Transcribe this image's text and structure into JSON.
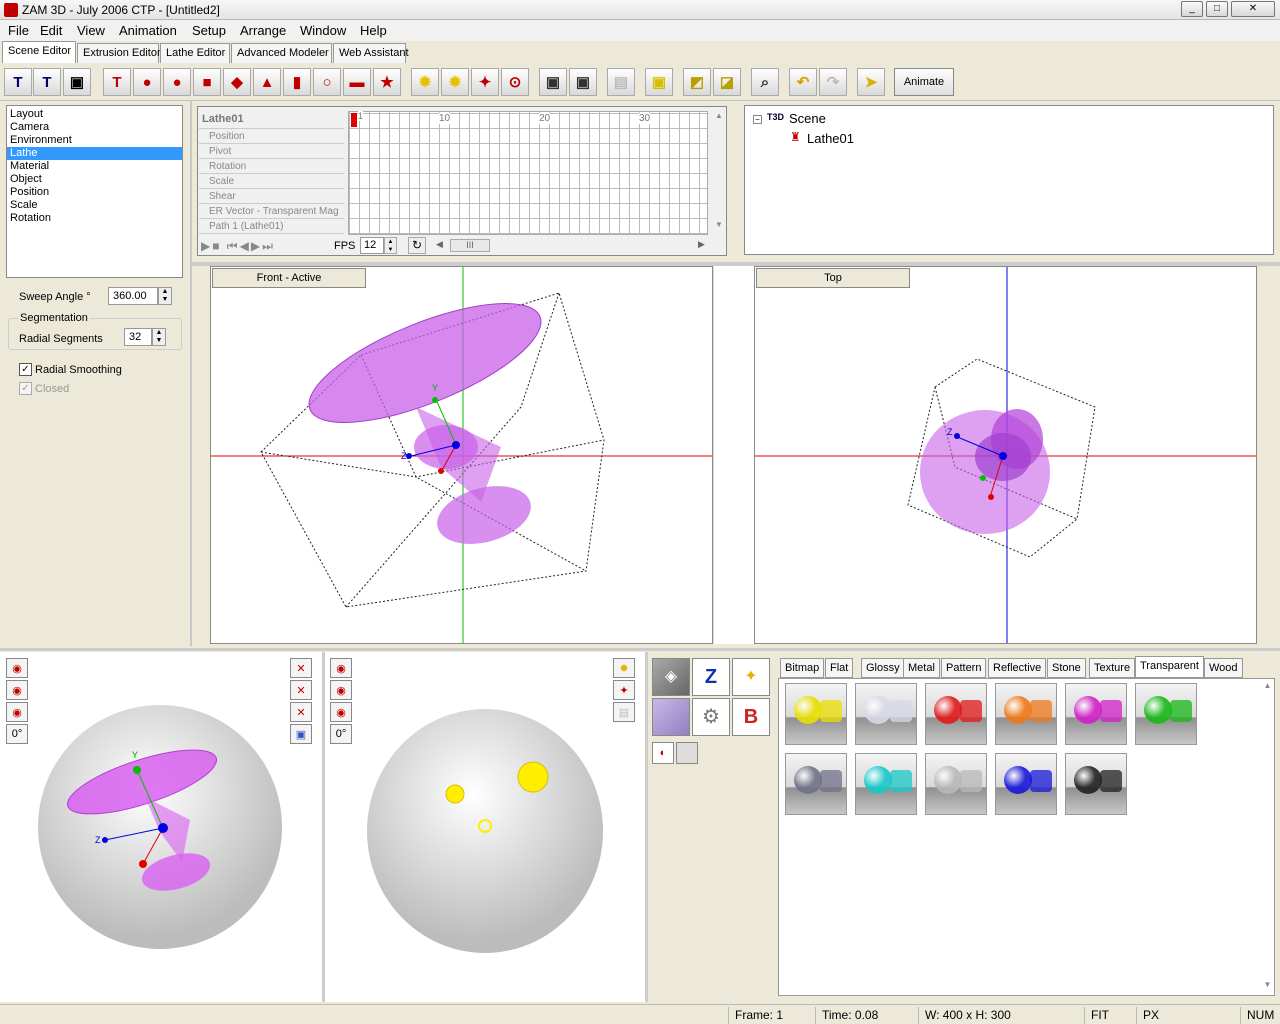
{
  "window": {
    "title": "ZAM 3D - July 2006 CTP - [Untitled2]",
    "minimize": "_",
    "maximize": "□",
    "close": "✕"
  },
  "menu": [
    "File",
    "Edit",
    "View",
    "Animation",
    "Setup",
    "Arrange",
    "Window",
    "Help"
  ],
  "editor_tabs": [
    "Scene Editor",
    "Extrusion Editor",
    "Lathe Editor",
    "Advanced Modeler",
    "Web Assistant"
  ],
  "toolbar": {
    "animate_label": "Animate",
    "icons": [
      "new-scene-icon",
      "import-scene-icon",
      "save-icon",
      "text-icon",
      "sphere-icon",
      "sphere-bevel-icon",
      "cube-icon",
      "pyramid-icon",
      "cone-icon",
      "cylinder-icon",
      "torus-icon",
      "plane-icon",
      "star-icon",
      "light-icon",
      "spot-light-icon",
      "remove-light-icon",
      "directional-light-icon",
      "camera-icon",
      "add-camera-icon",
      "disabled-tool-icon",
      "frame-icon",
      "view-front-icon",
      "view-top-icon",
      "zoom-icon",
      "undo-icon",
      "redo-icon",
      "pointer-icon"
    ]
  },
  "scene_list": {
    "items": [
      "Layout",
      "Camera",
      "Environment",
      "Lathe",
      "Material",
      "Object",
      "Position",
      "Scale",
      "Rotation"
    ],
    "selected": "Lathe"
  },
  "properties": {
    "sweep_angle_label": "Sweep Angle °",
    "sweep_angle_value": "360.00",
    "segmentation_label": "Segmentation",
    "radial_segments_label": "Radial Segments",
    "radial_segments_value": "32",
    "radial_smoothing_label": "Radial Smoothing",
    "closed_label": "Closed"
  },
  "timeline": {
    "object": "Lathe01",
    "tracks": [
      "Position",
      "Pivot",
      "Rotation",
      "Scale",
      "Shear",
      "ER Vector - Transparent Mag",
      "Path 1 (Lathe01)"
    ],
    "ticks": [
      "1",
      "10",
      "20",
      "30"
    ],
    "fps_label": "FPS",
    "fps_value": "12",
    "scroll_thumb": "III"
  },
  "scene_tree": {
    "root": "Scene",
    "child": "Lathe01"
  },
  "viewports": {
    "front": "Front - Active",
    "top": "Top"
  },
  "rotation_controls": {
    "angle1": "0°",
    "angle2": "0°"
  },
  "material_tabs": [
    "Bitmap",
    "Flat",
    "Glossy",
    "Metal",
    "Pattern",
    "Reflective",
    "Stone",
    "Texture",
    "Transparent",
    "Wood"
  ],
  "active_material_tab": "Transparent",
  "swatches": [
    "#e8e000",
    "#d8d8e8",
    "#e01818",
    "#f07818",
    "#d020c8",
    "#18b818",
    "#707088",
    "#18c8c8",
    "#b8b8b8",
    "#1818d8",
    "#202020"
  ],
  "status": {
    "frame": "Frame: 1",
    "time": "Time: 0.08",
    "size": "W: 400 x H: 300",
    "fit": "FIT",
    "units": "PX",
    "num": "NUM"
  },
  "colors": {
    "selection": "#3399ff",
    "object": "#c860e8",
    "axis_x": "#e00000",
    "axis_y": "#00c000",
    "axis_z": "#0000e0",
    "light": "#ffee00"
  }
}
